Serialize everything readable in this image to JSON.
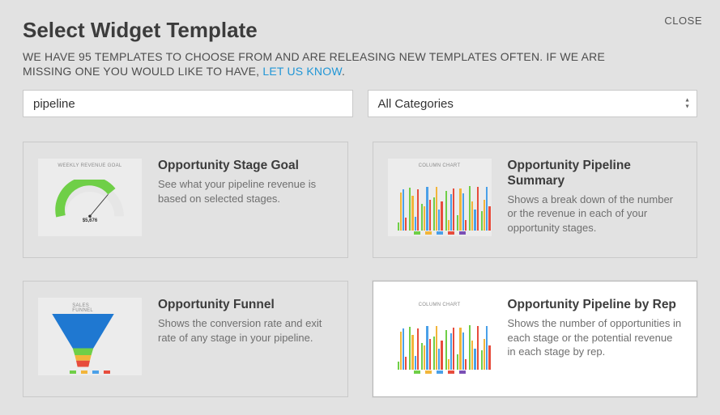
{
  "close": "CLOSE",
  "header": {
    "title": "Select Widget Template",
    "subtitle_part1": "WE HAVE 95 TEMPLATES TO CHOOSE FROM AND ARE RELEASING NEW TEMPLATES OFTEN. IF WE ARE MISSING ONE YOU WOULD LIKE TO HAVE, ",
    "subtitle_link": "LET US KNOW",
    "subtitle_end": "."
  },
  "controls": {
    "search_value": "pipeline",
    "category_value": "All Categories"
  },
  "cards": [
    {
      "title": "Opportunity Stage Goal",
      "desc": "See what your pipeline revenue is based on selected stages.",
      "thumb_label": "WEEKLY REVENUE GOAL",
      "gauge_value": "$5,676"
    },
    {
      "title": "Opportunity Pipeline Summary",
      "desc": "Shows a break down of the number or the revenue in each of your opportunity stages.",
      "thumb_label": "COLUMN CHART"
    },
    {
      "title": "Opportunity Funnel",
      "desc": "Shows the conversion rate and exit rate of any stage in your pipeline.",
      "thumb_label": "SALES FUNNEL"
    },
    {
      "title": "Opportunity Pipeline by Rep",
      "desc": "Shows the number of opportunities in each stage or the potential revenue in each stage by rep.",
      "thumb_label": "COLUMN CHART"
    }
  ],
  "chart_colors": [
    "#6fcf47",
    "#f2b53a",
    "#4aa0e8",
    "#e74c3c",
    "#7a4fb5"
  ]
}
